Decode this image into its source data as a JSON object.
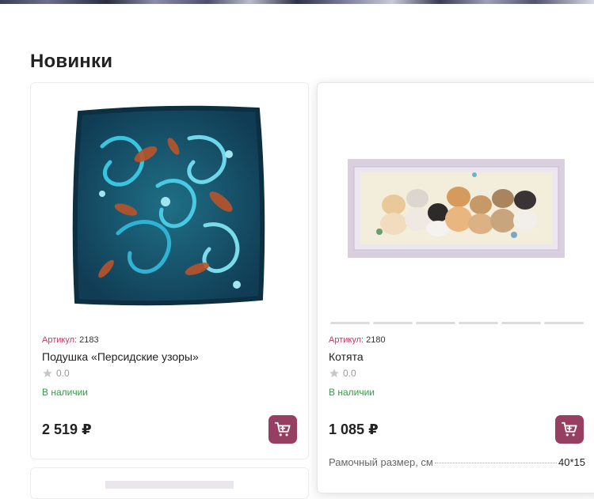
{
  "section": {
    "title": "Новинки"
  },
  "products": [
    {
      "sku_label": "Артикул:",
      "sku": "2183",
      "name": "Подушка «Персидские узоры»",
      "rating": "0.0",
      "stock": "В наличии",
      "price": "2 519",
      "currency": "₽",
      "image_icon": "cross-stitch-pillow-image"
    },
    {
      "sku_label": "Артикул:",
      "sku": "2180",
      "name": "Котята",
      "rating": "0.0",
      "stock": "В наличии",
      "price": "1 085",
      "currency": "₽",
      "image_icon": "kittens-embroidery-image",
      "spec_label": "Рамочный размер, см",
      "spec_value": "40*15"
    }
  ],
  "colors": {
    "accent": "#973e63",
    "sku_label": "#c7356c",
    "in_stock": "#2ea043"
  }
}
